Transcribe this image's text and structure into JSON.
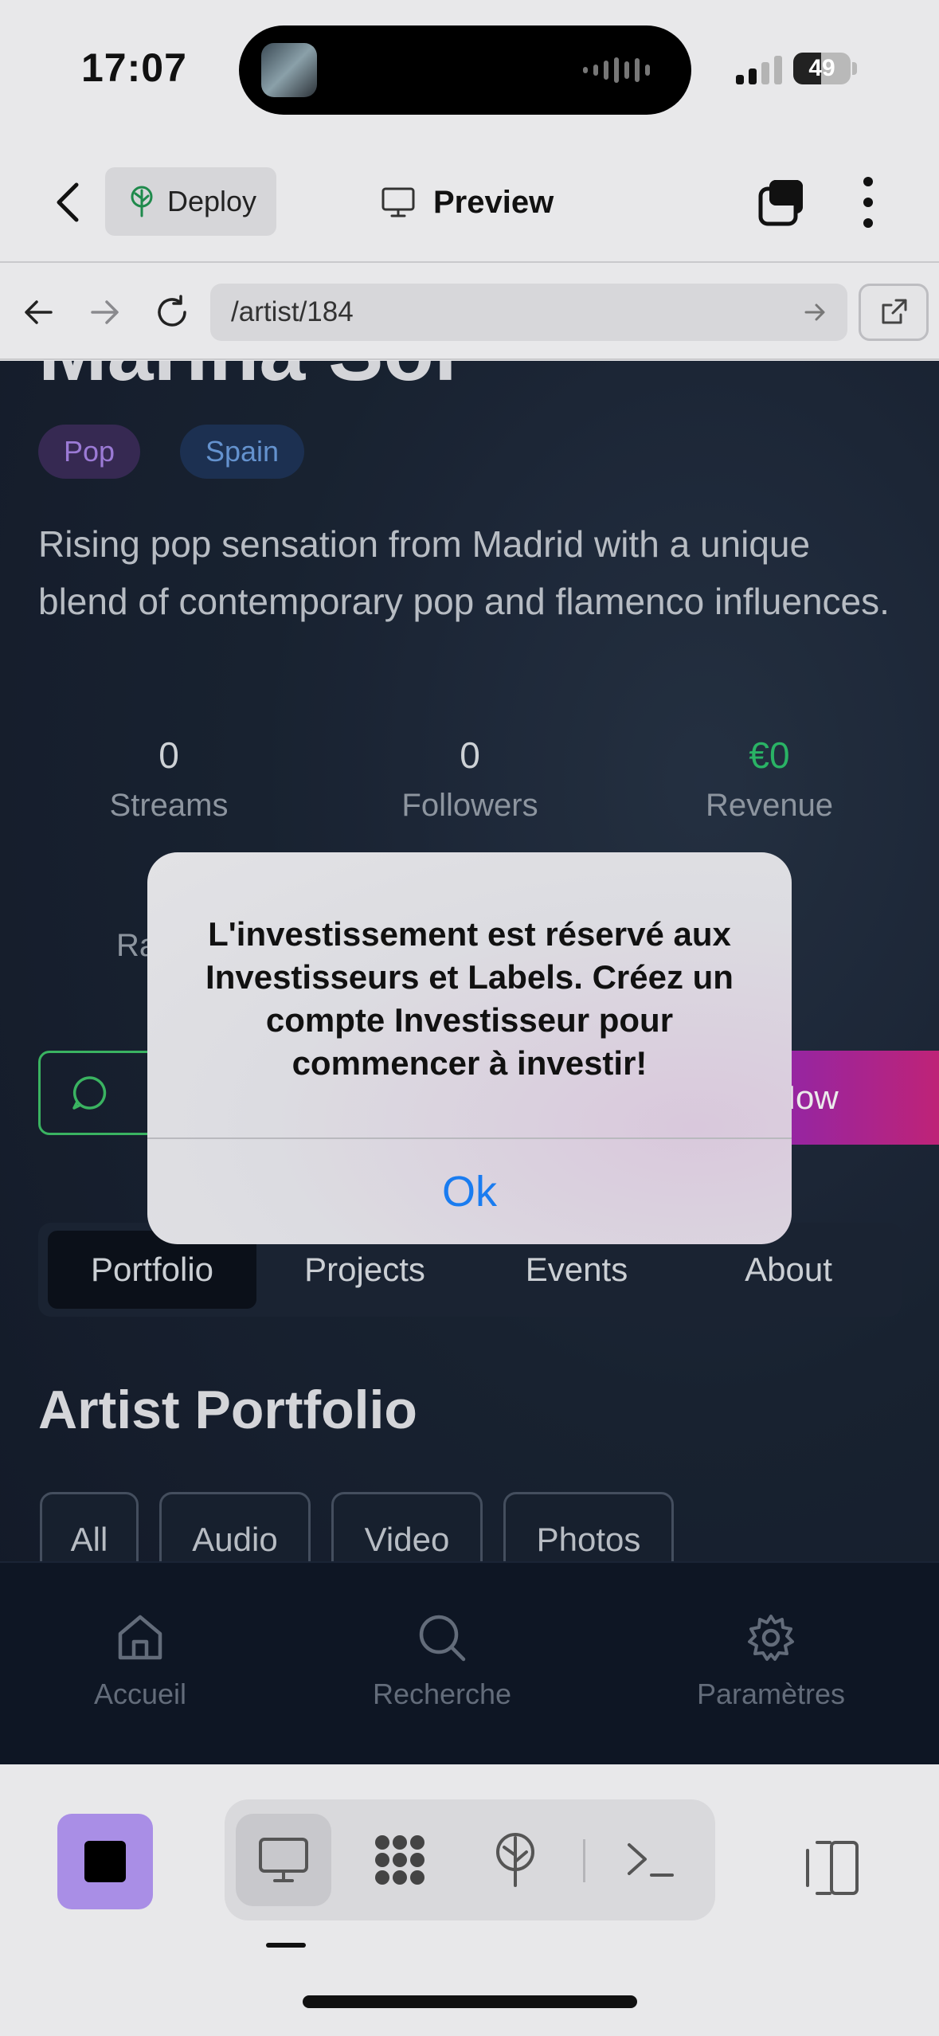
{
  "status_bar": {
    "time": "17:07",
    "battery": "49",
    "battery_level": 0.49
  },
  "app_bar": {
    "deploy_label": "Deploy",
    "preview_label": "Preview"
  },
  "url_bar": {
    "url": "/artist/184"
  },
  "artist": {
    "name": "Marina Sol",
    "genre": "Pop",
    "country": "Spain",
    "bio": "Rising pop sensation from Madrid with a unique blend of contemporary pop and flamenco influences.",
    "stats": [
      {
        "value": "0",
        "label": "Streams"
      },
      {
        "value": "0",
        "label": "Followers"
      },
      {
        "value": "€0",
        "label": "Revenue"
      }
    ],
    "stats_row2_partial_left": "Ra",
    "invest_label": "Invest Now"
  },
  "content_tabs": [
    "Portfolio",
    "Projects",
    "Events",
    "About"
  ],
  "portfolio": {
    "title": "Artist Portfolio",
    "filters": [
      "All",
      "Audio",
      "Video",
      "Photos"
    ]
  },
  "bottom_nav": [
    {
      "label": "Accueil",
      "icon": "home-icon"
    },
    {
      "label": "Recherche",
      "icon": "search-icon"
    },
    {
      "label": "Paramètres",
      "icon": "gear-icon"
    }
  ],
  "alert": {
    "message": "L'investissement est réservé aux Investisseurs et Labels. Créez un compte Investisseur pour commencer à investir!",
    "ok_label": "Ok"
  },
  "colors": {
    "accent_green": "#2ec36e",
    "alert_button": "#1a7cf0",
    "stop_button": "#a98ee6"
  }
}
